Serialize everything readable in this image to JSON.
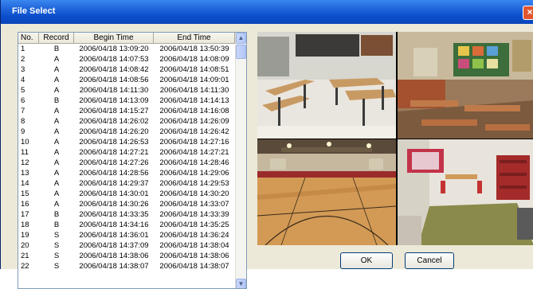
{
  "window": {
    "title": "File Select",
    "close_glyph": "×"
  },
  "table": {
    "columns": [
      "No.",
      "Record",
      "Begin Time",
      "End Time"
    ],
    "rows": [
      [
        "1",
        "B",
        "2006/04/18 13:09:20",
        "2006/04/18 13:50:39"
      ],
      [
        "2",
        "A",
        "2006/04/18 14:07:53",
        "2006/04/18 14:08:09"
      ],
      [
        "3",
        "A",
        "2006/04/18 14:08:42",
        "2006/04/18 14:08:51"
      ],
      [
        "4",
        "A",
        "2006/04/18 14:08:56",
        "2006/04/18 14:09:01"
      ],
      [
        "5",
        "A",
        "2006/04/18 14:11:30",
        "2006/04/18 14:11:30"
      ],
      [
        "6",
        "B",
        "2006/04/18 14:13:09",
        "2006/04/18 14:14:13"
      ],
      [
        "7",
        "A",
        "2006/04/18 14:15:27",
        "2006/04/18 14:16:08"
      ],
      [
        "8",
        "A",
        "2006/04/18 14:26:02",
        "2006/04/18 14:26:09"
      ],
      [
        "9",
        "A",
        "2006/04/18 14:26:20",
        "2006/04/18 14:26:42"
      ],
      [
        "10",
        "A",
        "2006/04/18 14:26:53",
        "2006/04/18 14:27:16"
      ],
      [
        "11",
        "A",
        "2006/04/18 14:27:21",
        "2006/04/18 14:27:21"
      ],
      [
        "12",
        "A",
        "2006/04/18 14:27:26",
        "2006/04/18 14:28:46"
      ],
      [
        "13",
        "A",
        "2006/04/18 14:28:56",
        "2006/04/18 14:29:06"
      ],
      [
        "14",
        "A",
        "2006/04/18 14:29:37",
        "2006/04/18 14:29:53"
      ],
      [
        "15",
        "A",
        "2006/04/18 14:30:01",
        "2006/04/18 14:30:20"
      ],
      [
        "16",
        "A",
        "2006/04/18 14:30:26",
        "2006/04/18 14:33:07"
      ],
      [
        "17",
        "B",
        "2006/04/18 14:33:35",
        "2006/04/18 14:33:39"
      ],
      [
        "18",
        "B",
        "2006/04/18 14:34:16",
        "2006/04/18 14:35:25"
      ],
      [
        "19",
        "S",
        "2006/04/18 14:36:01",
        "2006/04/18 14:36:24"
      ],
      [
        "20",
        "S",
        "2006/04/18 14:37:09",
        "2006/04/18 14:38:04"
      ],
      [
        "21",
        "S",
        "2006/04/18 14:38:06",
        "2006/04/18 14:38:06"
      ],
      [
        "22",
        "S",
        "2006/04/18 14:38:07",
        "2006/04/18 14:38:07"
      ]
    ]
  },
  "scrollbar": {
    "up_glyph": "▲",
    "down_glyph": "▼"
  },
  "buttons": {
    "ok": "OK",
    "cancel": "Cancel"
  },
  "colors": {
    "titlebar": "#0a4dcc",
    "close": "#e2562f",
    "list_border": "#7f9db9",
    "dialog_bg": "#ece9d8"
  }
}
